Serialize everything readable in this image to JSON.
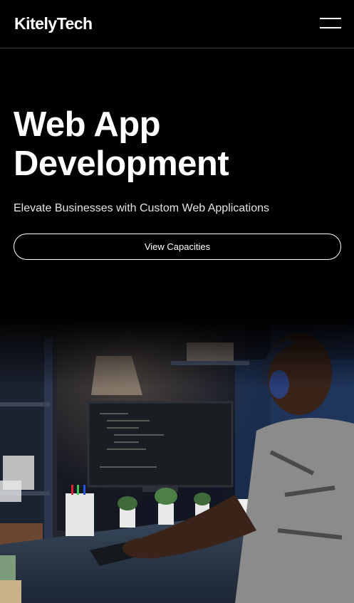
{
  "header": {
    "logo": "KitelyTech",
    "menu_icon": "hamburger-menu-icon"
  },
  "hero": {
    "title_line1": "Web App",
    "title_line2": "Development",
    "subtitle": "Elevate Businesses with Custom Web Applications",
    "cta_label": "View Capacities"
  },
  "colors": {
    "background": "#000000",
    "text": "#ffffff",
    "divider": "#3a3a3a"
  }
}
